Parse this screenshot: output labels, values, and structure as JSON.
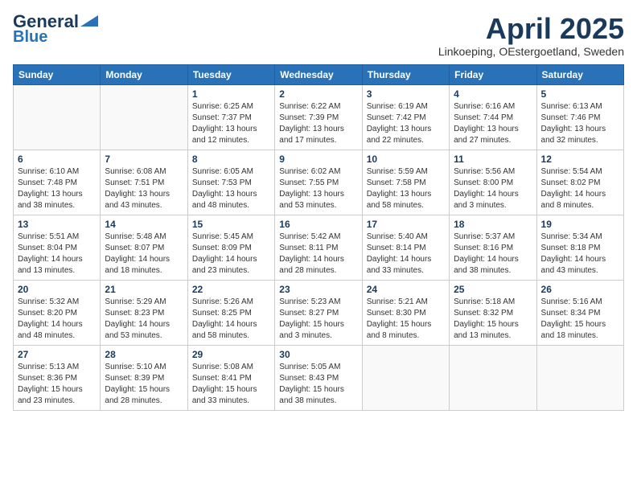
{
  "header": {
    "logo_line1": "General",
    "logo_line2": "Blue",
    "month_title": "April 2025",
    "location": "Linkoeping, OEstergoetland, Sweden"
  },
  "weekdays": [
    "Sunday",
    "Monday",
    "Tuesday",
    "Wednesday",
    "Thursday",
    "Friday",
    "Saturday"
  ],
  "weeks": [
    [
      {
        "day": "",
        "info": ""
      },
      {
        "day": "",
        "info": ""
      },
      {
        "day": "1",
        "info": "Sunrise: 6:25 AM\nSunset: 7:37 PM\nDaylight: 13 hours and 12 minutes."
      },
      {
        "day": "2",
        "info": "Sunrise: 6:22 AM\nSunset: 7:39 PM\nDaylight: 13 hours and 17 minutes."
      },
      {
        "day": "3",
        "info": "Sunrise: 6:19 AM\nSunset: 7:42 PM\nDaylight: 13 hours and 22 minutes."
      },
      {
        "day": "4",
        "info": "Sunrise: 6:16 AM\nSunset: 7:44 PM\nDaylight: 13 hours and 27 minutes."
      },
      {
        "day": "5",
        "info": "Sunrise: 6:13 AM\nSunset: 7:46 PM\nDaylight: 13 hours and 32 minutes."
      }
    ],
    [
      {
        "day": "6",
        "info": "Sunrise: 6:10 AM\nSunset: 7:48 PM\nDaylight: 13 hours and 38 minutes."
      },
      {
        "day": "7",
        "info": "Sunrise: 6:08 AM\nSunset: 7:51 PM\nDaylight: 13 hours and 43 minutes."
      },
      {
        "day": "8",
        "info": "Sunrise: 6:05 AM\nSunset: 7:53 PM\nDaylight: 13 hours and 48 minutes."
      },
      {
        "day": "9",
        "info": "Sunrise: 6:02 AM\nSunset: 7:55 PM\nDaylight: 13 hours and 53 minutes."
      },
      {
        "day": "10",
        "info": "Sunrise: 5:59 AM\nSunset: 7:58 PM\nDaylight: 13 hours and 58 minutes."
      },
      {
        "day": "11",
        "info": "Sunrise: 5:56 AM\nSunset: 8:00 PM\nDaylight: 14 hours and 3 minutes."
      },
      {
        "day": "12",
        "info": "Sunrise: 5:54 AM\nSunset: 8:02 PM\nDaylight: 14 hours and 8 minutes."
      }
    ],
    [
      {
        "day": "13",
        "info": "Sunrise: 5:51 AM\nSunset: 8:04 PM\nDaylight: 14 hours and 13 minutes."
      },
      {
        "day": "14",
        "info": "Sunrise: 5:48 AM\nSunset: 8:07 PM\nDaylight: 14 hours and 18 minutes."
      },
      {
        "day": "15",
        "info": "Sunrise: 5:45 AM\nSunset: 8:09 PM\nDaylight: 14 hours and 23 minutes."
      },
      {
        "day": "16",
        "info": "Sunrise: 5:42 AM\nSunset: 8:11 PM\nDaylight: 14 hours and 28 minutes."
      },
      {
        "day": "17",
        "info": "Sunrise: 5:40 AM\nSunset: 8:14 PM\nDaylight: 14 hours and 33 minutes."
      },
      {
        "day": "18",
        "info": "Sunrise: 5:37 AM\nSunset: 8:16 PM\nDaylight: 14 hours and 38 minutes."
      },
      {
        "day": "19",
        "info": "Sunrise: 5:34 AM\nSunset: 8:18 PM\nDaylight: 14 hours and 43 minutes."
      }
    ],
    [
      {
        "day": "20",
        "info": "Sunrise: 5:32 AM\nSunset: 8:20 PM\nDaylight: 14 hours and 48 minutes."
      },
      {
        "day": "21",
        "info": "Sunrise: 5:29 AM\nSunset: 8:23 PM\nDaylight: 14 hours and 53 minutes."
      },
      {
        "day": "22",
        "info": "Sunrise: 5:26 AM\nSunset: 8:25 PM\nDaylight: 14 hours and 58 minutes."
      },
      {
        "day": "23",
        "info": "Sunrise: 5:23 AM\nSunset: 8:27 PM\nDaylight: 15 hours and 3 minutes."
      },
      {
        "day": "24",
        "info": "Sunrise: 5:21 AM\nSunset: 8:30 PM\nDaylight: 15 hours and 8 minutes."
      },
      {
        "day": "25",
        "info": "Sunrise: 5:18 AM\nSunset: 8:32 PM\nDaylight: 15 hours and 13 minutes."
      },
      {
        "day": "26",
        "info": "Sunrise: 5:16 AM\nSunset: 8:34 PM\nDaylight: 15 hours and 18 minutes."
      }
    ],
    [
      {
        "day": "27",
        "info": "Sunrise: 5:13 AM\nSunset: 8:36 PM\nDaylight: 15 hours and 23 minutes."
      },
      {
        "day": "28",
        "info": "Sunrise: 5:10 AM\nSunset: 8:39 PM\nDaylight: 15 hours and 28 minutes."
      },
      {
        "day": "29",
        "info": "Sunrise: 5:08 AM\nSunset: 8:41 PM\nDaylight: 15 hours and 33 minutes."
      },
      {
        "day": "30",
        "info": "Sunrise: 5:05 AM\nSunset: 8:43 PM\nDaylight: 15 hours and 38 minutes."
      },
      {
        "day": "",
        "info": ""
      },
      {
        "day": "",
        "info": ""
      },
      {
        "day": "",
        "info": ""
      }
    ]
  ]
}
